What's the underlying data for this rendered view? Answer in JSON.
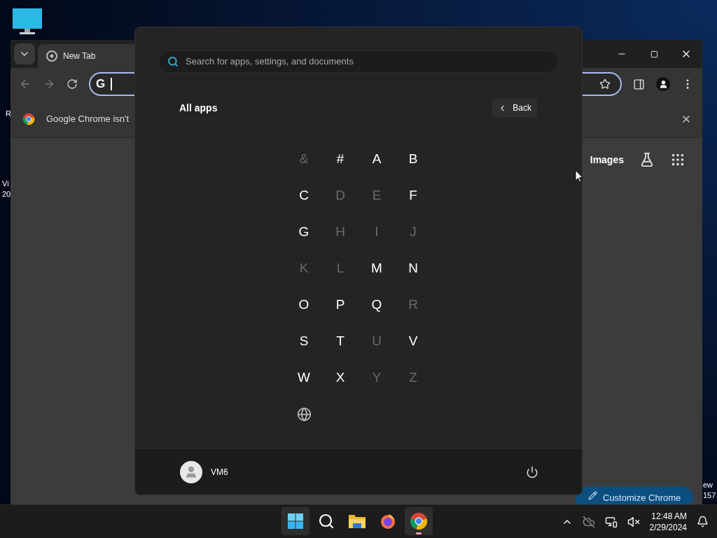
{
  "desktop": {
    "fragments": [
      [
        "R"
      ],
      [
        "Vi",
        "20"
      ],
      [
        "ew",
        "157"
      ]
    ]
  },
  "browser": {
    "tab": {
      "title": "New Tab"
    },
    "omnibox": {
      "logo": "G"
    },
    "infobar": {
      "text": "Google Chrome isn't"
    },
    "new_tab_page": {
      "links": [
        "Images"
      ],
      "customize_button": "Customize Chrome"
    }
  },
  "start_menu": {
    "search": {
      "placeholder": "Search for apps, settings, and documents"
    },
    "heading": "All apps",
    "back_button": "Back",
    "letters": [
      {
        "kind": "char",
        "label": "&",
        "disabled": true
      },
      {
        "kind": "char",
        "label": "#",
        "disabled": false
      },
      {
        "kind": "char",
        "label": "A",
        "disabled": false
      },
      {
        "kind": "char",
        "label": "B",
        "disabled": false
      },
      {
        "kind": "char",
        "label": "C",
        "disabled": false
      },
      {
        "kind": "char",
        "label": "D",
        "disabled": true
      },
      {
        "kind": "char",
        "label": "E",
        "disabled": true
      },
      {
        "kind": "char",
        "label": "F",
        "disabled": false
      },
      {
        "kind": "char",
        "label": "G",
        "disabled": false
      },
      {
        "kind": "char",
        "label": "H",
        "disabled": true
      },
      {
        "kind": "char",
        "label": "I",
        "disabled": true
      },
      {
        "kind": "char",
        "label": "J",
        "disabled": true
      },
      {
        "kind": "char",
        "label": "K",
        "disabled": true
      },
      {
        "kind": "char",
        "label": "L",
        "disabled": true
      },
      {
        "kind": "char",
        "label": "M",
        "disabled": false
      },
      {
        "kind": "char",
        "label": "N",
        "disabled": false
      },
      {
        "kind": "char",
        "label": "O",
        "disabled": false
      },
      {
        "kind": "char",
        "label": "P",
        "disabled": false
      },
      {
        "kind": "char",
        "label": "Q",
        "disabled": false
      },
      {
        "kind": "char",
        "label": "R",
        "disabled": true
      },
      {
        "kind": "char",
        "label": "S",
        "disabled": false
      },
      {
        "kind": "char",
        "label": "T",
        "disabled": false
      },
      {
        "kind": "char",
        "label": "U",
        "disabled": true
      },
      {
        "kind": "char",
        "label": "V",
        "disabled": false
      },
      {
        "kind": "char",
        "label": "W",
        "disabled": false
      },
      {
        "kind": "char",
        "label": "X",
        "disabled": false
      },
      {
        "kind": "char",
        "label": "Y",
        "disabled": true
      },
      {
        "kind": "char",
        "label": "Z",
        "disabled": true
      },
      {
        "kind": "globe",
        "disabled": false
      }
    ],
    "user": {
      "name": "VM6"
    }
  },
  "taskbar": {
    "apps": [
      {
        "kind": "start",
        "selected": true
      },
      {
        "kind": "search",
        "selected": false
      },
      {
        "kind": "files",
        "selected": false
      },
      {
        "kind": "firefox",
        "selected": false
      },
      {
        "kind": "chrome",
        "selected": true
      }
    ],
    "clock": {
      "time": "12:48 AM",
      "date": "2/29/2024"
    }
  }
}
